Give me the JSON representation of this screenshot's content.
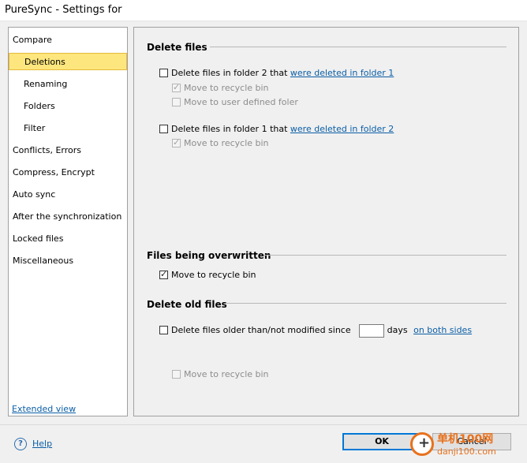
{
  "window": {
    "title": "PureSync - Settings for"
  },
  "sidebar": {
    "items": [
      {
        "label": "Compare"
      },
      {
        "label": "Deletions"
      },
      {
        "label": "Renaming"
      },
      {
        "label": "Folders"
      },
      {
        "label": "Filter"
      },
      {
        "label": "Conflicts, Errors"
      },
      {
        "label": "Compress, Encrypt"
      },
      {
        "label": "Auto sync"
      },
      {
        "label": "After the synchronization"
      },
      {
        "label": "Locked files"
      },
      {
        "label": "Miscellaneous"
      }
    ],
    "selected": "Deletions",
    "extended_view": "Extended view"
  },
  "delete_files": {
    "title": "Delete files",
    "folder2": {
      "label": "Delete files in folder 2 that",
      "link": "were deleted in folder 1",
      "recycle": "Move to recycle bin",
      "user_defined": "Move to user defined foler"
    },
    "folder1": {
      "label": "Delete files in folder 1 that",
      "link": "were deleted in folder 2",
      "recycle": "Move to recycle bin"
    }
  },
  "overwritten": {
    "title": "Files being overwritten",
    "recycle": "Move to recycle bin"
  },
  "old_files": {
    "title": "Delete old files",
    "label": "Delete files older than/not modified since",
    "days": "days",
    "link": "on both sides",
    "recycle": "Move to recycle bin"
  },
  "footer": {
    "help": "Help",
    "ok": "OK",
    "cancel": "Cancel"
  },
  "watermark": {
    "text1": "单机100网",
    "text2": "danji100.com"
  }
}
